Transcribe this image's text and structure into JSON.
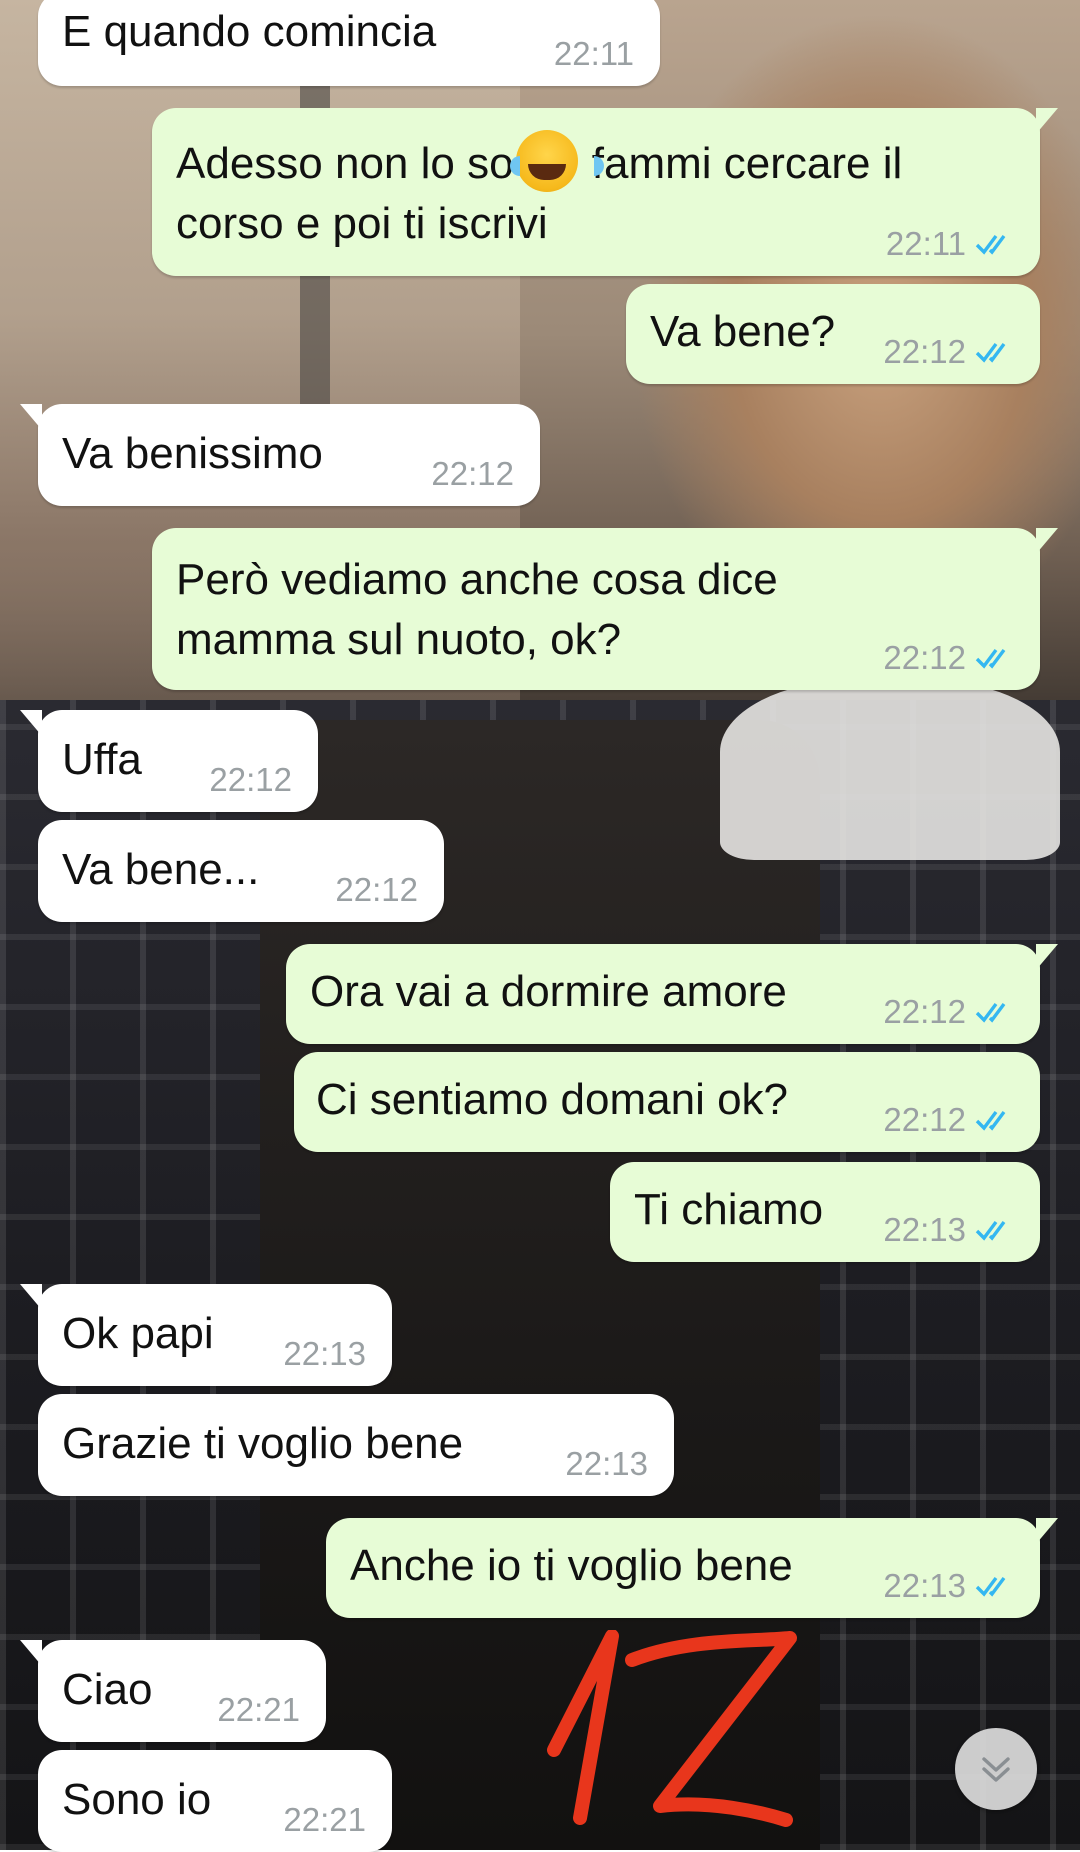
{
  "messages": [
    {
      "direction": "in",
      "text": "E quando comincia",
      "time": "22:11"
    },
    {
      "direction": "out",
      "text_before_emoji": "Adesso non lo so",
      "emoji": "face-with-tears-of-joy",
      "text_after_emoji": " fammi cercare il\ncorso e poi ti iscrivi",
      "time": "22:11",
      "status": "read"
    },
    {
      "direction": "out",
      "text": "Va bene?",
      "time": "22:12",
      "status": "read"
    },
    {
      "direction": "in",
      "text": "Va benissimo",
      "time": "22:12"
    },
    {
      "direction": "out",
      "text": "Però vediamo anche cosa dice\nmamma sul nuoto, ok?",
      "time": "22:12",
      "status": "read"
    },
    {
      "direction": "in",
      "text": "Uffa",
      "time": "22:12"
    },
    {
      "direction": "in",
      "text": "Va bene...",
      "time": "22:12"
    },
    {
      "direction": "out",
      "text": "Ora vai a dormire amore",
      "time": "22:12",
      "status": "read"
    },
    {
      "direction": "out",
      "text": "Ci sentiamo domani ok?",
      "time": "22:12",
      "status": "read"
    },
    {
      "direction": "out",
      "text": "Ti chiamo",
      "time": "22:13",
      "status": "read"
    },
    {
      "direction": "in",
      "text": "Ok papi",
      "time": "22:13"
    },
    {
      "direction": "in",
      "text": "Grazie ti voglio bene",
      "time": "22:13"
    },
    {
      "direction": "out",
      "text": "Anche io ti voglio bene",
      "time": "22:13",
      "status": "read"
    },
    {
      "direction": "in",
      "text": "Ciao",
      "time": "22:21"
    },
    {
      "direction": "in",
      "text": "Sono io",
      "time": "22:21"
    }
  ],
  "annotation": {
    "text": "12",
    "color": "#e8361c"
  },
  "colors": {
    "incoming_bubble": "#ffffff",
    "outgoing_bubble": "#e7fcd6",
    "read_tick": "#34b7f1",
    "timestamp": "#9aa0a3"
  },
  "icons": {
    "read_receipt": "double-check-icon",
    "scroll_button": "double-chevron-down-icon"
  }
}
